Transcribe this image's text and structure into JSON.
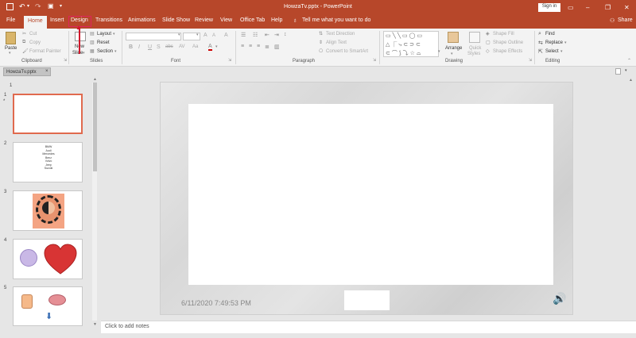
{
  "titlebar": {
    "title": "HowzaTv.pptx  -  PowerPoint",
    "signin": "Sign in",
    "minimize": "–",
    "restore": "❐",
    "close": "✕",
    "ribbon_options": "▭",
    "save_icon": "save-icon",
    "undo_icon": "undo-icon",
    "redo_icon": "redo-icon"
  },
  "tabs": {
    "file": "File",
    "home": "Home",
    "insert": "Insert",
    "design": "Design",
    "transitions": "Transitions",
    "animations": "Animations",
    "slideshow": "Slide Show",
    "review": "Review",
    "view": "View",
    "officetab": "Office Tab",
    "help": "Help",
    "tellme": "Tell me what you want to do",
    "share": "Share"
  },
  "ribbon": {
    "clipboard": {
      "paste": "Paste",
      "cut": "Cut",
      "copy": "Copy",
      "format_painter": "Format Painter",
      "label": "Clipboard"
    },
    "slides": {
      "new_slide_1": "New",
      "new_slide_2": "Slide",
      "layout": "Layout",
      "reset": "Reset",
      "section": "Section",
      "label": "Slides"
    },
    "font": {
      "label": "Font",
      "bold": "B",
      "italic": "I",
      "underline": "U",
      "strike": "S",
      "shadow": "abc",
      "spacing": "AV",
      "case": "Aa",
      "grow": "A",
      "shrink": "A",
      "clear": "A"
    },
    "paragraph": {
      "label": "Paragraph",
      "text_direction": "Text Direction",
      "align_text": "Align Text",
      "convert_smartart": "Convert to SmartArt"
    },
    "drawing": {
      "label": "Drawing",
      "arrange": "Arrange",
      "quick_styles_1": "Quick",
      "quick_styles_2": "Styles",
      "shape_fill": "Shape Fill",
      "shape_outline": "Shape Outline",
      "shape_effects": "Shape Effects"
    },
    "editing": {
      "label": "Editing",
      "find": "Find",
      "replace": "Replace",
      "select": "Select"
    }
  },
  "doctab": {
    "name": "HowzaTv.pptx",
    "close": "×"
  },
  "thumbnails": [
    {
      "num": "1",
      "star": "*"
    },
    {
      "num": "2",
      "lines": [
        "BMW",
        "Audi",
        "Mercedes",
        "Benz",
        "Volvo",
        "Jeep",
        "Suzuki"
      ]
    },
    {
      "num": "3"
    },
    {
      "num": "4"
    },
    {
      "num": "5"
    }
  ],
  "section_marker": "1",
  "slide": {
    "date": "6/11/2020 7:49:53 PM"
  },
  "notes": {
    "placeholder": "Click to add notes"
  },
  "colors": {
    "accent": "#b7472a",
    "highlight": "#e0245e"
  }
}
